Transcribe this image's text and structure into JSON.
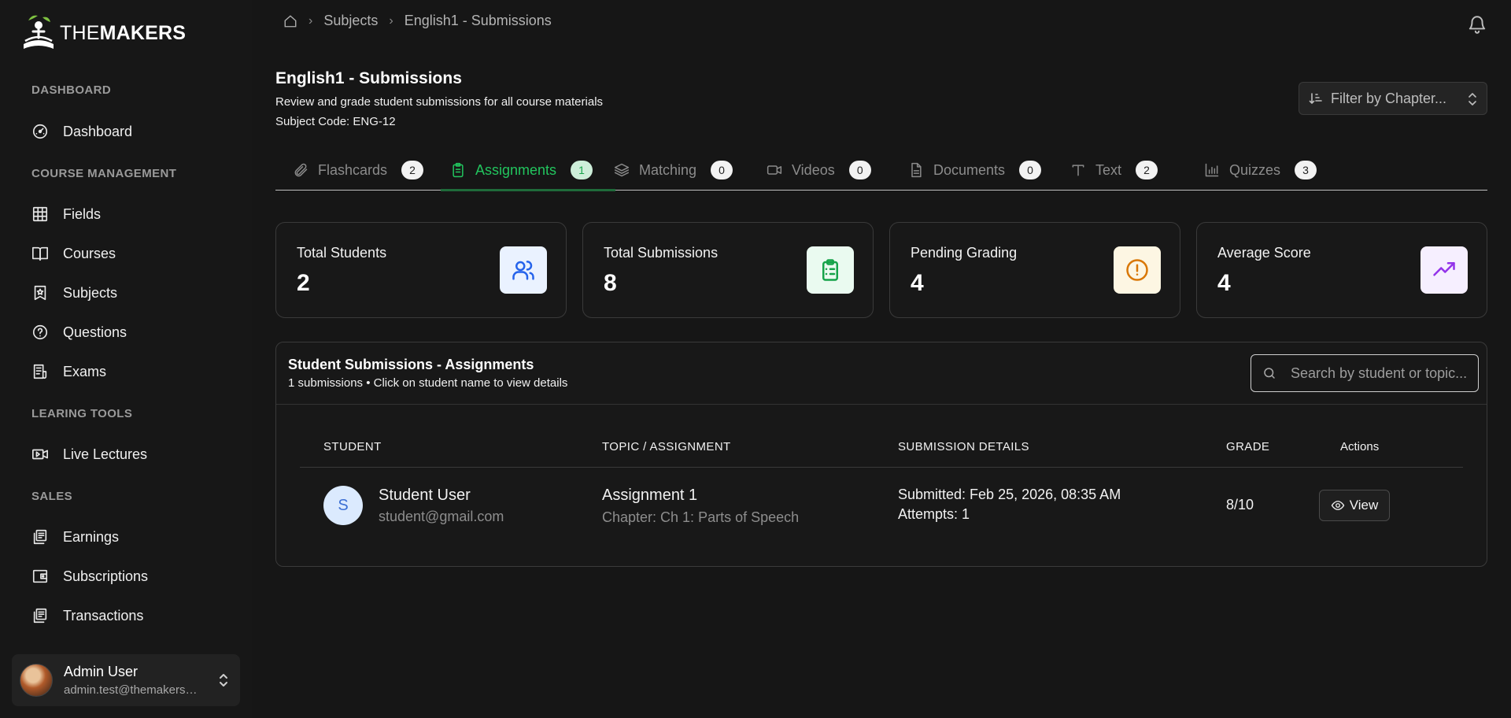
{
  "brand": {
    "prefix": "THE",
    "suffix": "MAKERS"
  },
  "sidebar": {
    "sections": [
      {
        "label": "DASHBOARD",
        "items": [
          {
            "label": "Dashboard",
            "icon": "gauge-icon"
          }
        ]
      },
      {
        "label": "COURSE MANAGEMENT",
        "items": [
          {
            "label": "Fields",
            "icon": "grid-icon"
          },
          {
            "label": "Courses",
            "icon": "book-open-icon"
          },
          {
            "label": "Subjects",
            "icon": "bookmark-star-icon"
          },
          {
            "label": "Questions",
            "icon": "question-circle-icon"
          },
          {
            "label": "Exams",
            "icon": "receipt-icon"
          }
        ]
      },
      {
        "label": "LEARING TOOLS",
        "items": [
          {
            "label": "Live Lectures",
            "icon": "video-icon"
          }
        ]
      },
      {
        "label": "SALES",
        "items": [
          {
            "label": "Earnings",
            "icon": "receipt-stack-icon"
          },
          {
            "label": "Subscriptions",
            "icon": "wallet-icon"
          },
          {
            "label": "Transactions",
            "icon": "receipt-stack-icon"
          }
        ]
      }
    ],
    "user": {
      "name": "Admin User",
      "email": "admin.test@themakers.com"
    }
  },
  "breadcrumb": {
    "items": [
      "Subjects",
      "English1 - Submissions"
    ]
  },
  "header": {
    "title": "English1 - Submissions",
    "subtitle": "Review and grade student submissions for all course materials",
    "code": "Subject Code: ENG-12",
    "filter_placeholder": "Filter by Chapter..."
  },
  "tabs": [
    {
      "label": "Flashcards",
      "count": "2",
      "icon": "paperclip-icon",
      "active": false
    },
    {
      "label": "Assignments",
      "count": "1",
      "icon": "clipboard-icon",
      "active": true
    },
    {
      "label": "Matching",
      "count": "0",
      "icon": "layers-icon",
      "active": false
    },
    {
      "label": "Videos",
      "count": "0",
      "icon": "video-icon",
      "active": false
    },
    {
      "label": "Documents",
      "count": "0",
      "icon": "document-icon",
      "active": false
    },
    {
      "label": "Text",
      "count": "2",
      "icon": "text-icon",
      "active": false
    },
    {
      "label": "Quizzes",
      "count": "3",
      "icon": "bar-chart-icon",
      "active": false
    }
  ],
  "stats": [
    {
      "label": "Total Students",
      "value": "2",
      "icon": "users-icon",
      "color": "#2563eb",
      "bg": "#eaf2ff"
    },
    {
      "label": "Total Submissions",
      "value": "8",
      "icon": "clipboard-list-icon",
      "color": "#16a34a",
      "bg": "#eafaf0"
    },
    {
      "label": "Pending Grading",
      "value": "4",
      "icon": "alert-circle-icon",
      "color": "#d97706",
      "bg": "#fdf6e3"
    },
    {
      "label": "Average Score",
      "value": "4",
      "icon": "trending-up-icon",
      "color": "#9333ea",
      "bg": "#f6efff"
    }
  ],
  "table": {
    "title": "Student Submissions - Assignments",
    "subtitle": "1 submissions • Click on student name to view details",
    "search_placeholder": "Search by student or topic...",
    "columns": [
      "STUDENT",
      "TOPIC / ASSIGNMENT",
      "SUBMISSION DETAILS",
      "GRADE",
      "Actions"
    ],
    "rows": [
      {
        "initial": "S",
        "name": "Student User",
        "email": "student@gmail.com",
        "topic": "Assignment 1",
        "chapter": "Chapter: Ch 1: Parts of Speech",
        "submitted": "Submitted: Feb 25, 2026, 08:35 AM",
        "attempts": "Attempts: 1",
        "grade": "8/10",
        "action": "View"
      }
    ]
  },
  "colors": {
    "accent": "#22c55e",
    "background": "#161616"
  }
}
